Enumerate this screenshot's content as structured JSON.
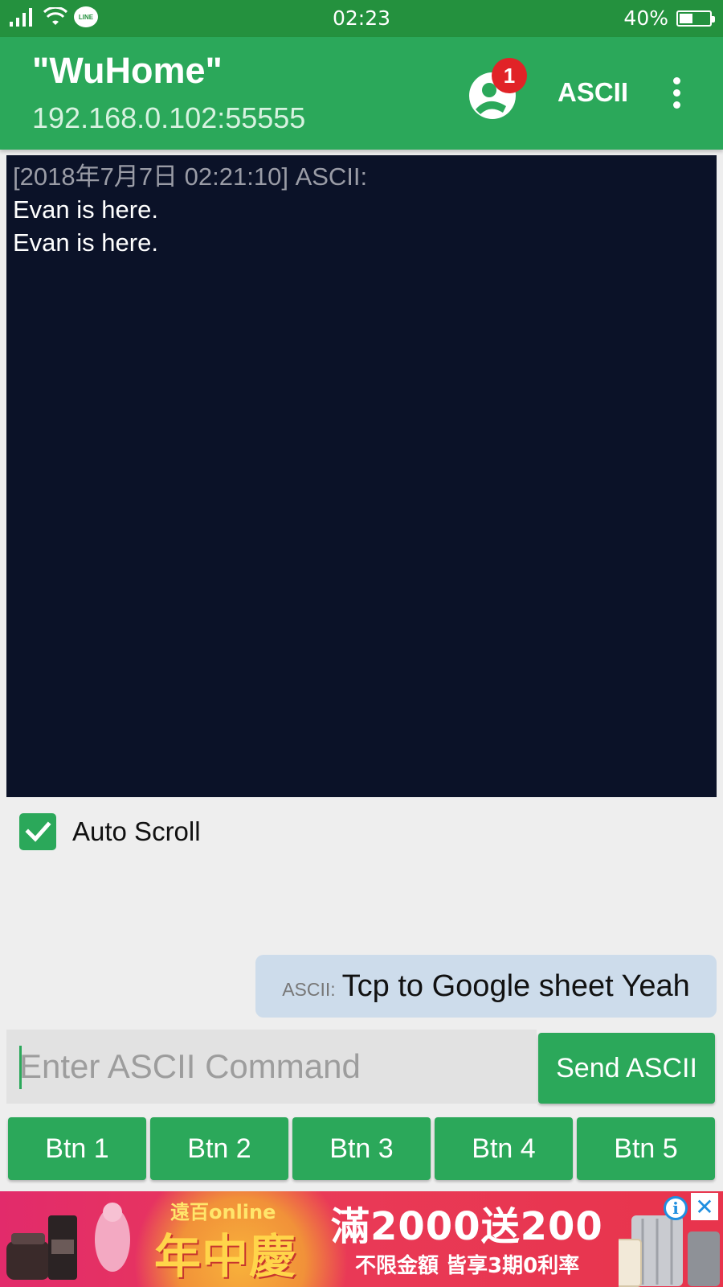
{
  "status_bar": {
    "time": "02:23",
    "battery": "40%",
    "notification_app_label": "LINE",
    "icons": [
      "signal-icon",
      "wifi-icon",
      "line-notification-icon",
      "battery-icon"
    ]
  },
  "app_bar": {
    "title": "\"WuHome\"",
    "subtitle": "192.168.0.102:55555",
    "badge_count": "1",
    "mode_label": "ASCII",
    "accent_color": "#2BA85A",
    "badge_color": "#E12327"
  },
  "terminal": {
    "lines": [
      {
        "text": "[2018年7月7日 02:21:10] ASCII:",
        "type": "stamp"
      },
      {
        "text": "Evan is here.",
        "type": "message"
      },
      {
        "text": "Evan is here.",
        "type": "message"
      }
    ],
    "background_color": "#0B1228"
  },
  "auto_scroll": {
    "label": "Auto Scroll",
    "checked": true
  },
  "last_sent": {
    "prefix": "ASCII:",
    "text": "Tcp to Google sheet Yeah"
  },
  "command_input": {
    "placeholder": "Enter ASCII Command",
    "value": ""
  },
  "send_button": {
    "label": "Send ASCII"
  },
  "quick_buttons": [
    {
      "label": "Btn 1"
    },
    {
      "label": "Btn 2"
    },
    {
      "label": "Btn 3"
    },
    {
      "label": "Btn 4"
    },
    {
      "label": "Btn 5"
    }
  ],
  "ad": {
    "brand": "遠百online",
    "headline": "年中慶",
    "promo": "滿2000送200",
    "fine_print": "不限金額 皆享3期0利率",
    "info_glyph": "i",
    "close_glyph": "✕"
  }
}
